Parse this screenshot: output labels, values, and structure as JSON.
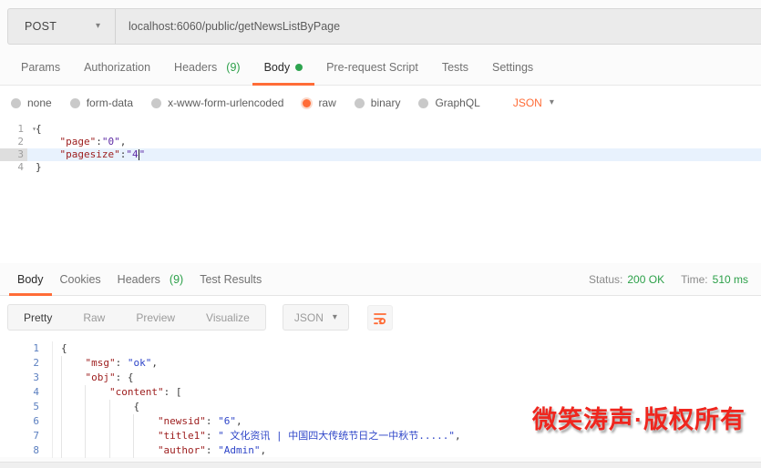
{
  "colors": {
    "accent": "#ff6c37",
    "success_green": "#2ca049",
    "watermark_red": "#ef261e"
  },
  "request": {
    "method": "POST",
    "url": "localhost:6060/public/getNewsListByPage",
    "tabs": [
      {
        "label": "Params"
      },
      {
        "label": "Authorization"
      },
      {
        "label": "Headers",
        "count": "(9)"
      },
      {
        "label": "Body",
        "active": true
      },
      {
        "label": "Pre-request Script"
      },
      {
        "label": "Tests"
      },
      {
        "label": "Settings"
      }
    ],
    "body_modes": [
      {
        "label": "none"
      },
      {
        "label": "form-data"
      },
      {
        "label": "x-www-form-urlencoded"
      },
      {
        "label": "raw",
        "selected": true
      },
      {
        "label": "binary"
      },
      {
        "label": "GraphQL"
      }
    ],
    "format": "JSON",
    "editor_lines": [
      {
        "n": "1",
        "fold": true,
        "indent": 0,
        "tokens": [
          {
            "c": "p",
            "t": "{"
          }
        ]
      },
      {
        "n": "2",
        "indent": 4,
        "tokens": [
          {
            "c": "key",
            "t": "\"page\""
          },
          {
            "c": "p",
            "t": ":"
          },
          {
            "c": "val",
            "t": "\"0\""
          },
          {
            "c": "p",
            "t": ","
          }
        ]
      },
      {
        "n": "3",
        "indent": 4,
        "active": true,
        "tokens": [
          {
            "c": "key",
            "t": "\"pagesize\""
          },
          {
            "c": "p",
            "t": ":"
          },
          {
            "c": "val",
            "t": "\"4"
          },
          {
            "c": "caret"
          },
          {
            "c": "val",
            "t": "\""
          }
        ]
      },
      {
        "n": "4",
        "indent": 0,
        "tokens": [
          {
            "c": "p",
            "t": "}"
          }
        ]
      }
    ]
  },
  "response": {
    "tabs": [
      {
        "label": "Body",
        "active": true
      },
      {
        "label": "Cookies"
      },
      {
        "label": "Headers",
        "count": "(9)"
      },
      {
        "label": "Test Results"
      }
    ],
    "status_label": "Status:",
    "status_value": "200 OK",
    "time_label": "Time:",
    "time_value": "510 ms",
    "view_tabs": [
      {
        "label": "Pretty",
        "active": true
      },
      {
        "label": "Raw"
      },
      {
        "label": "Preview"
      },
      {
        "label": "Visualize"
      }
    ],
    "format": "JSON",
    "editor_lines": [
      {
        "n": "1",
        "indent": 0,
        "tokens": [
          {
            "c": "p",
            "t": "{"
          }
        ]
      },
      {
        "n": "2",
        "indent": 4,
        "tokens": [
          {
            "c": "key",
            "t": "\"msg\""
          },
          {
            "c": "p",
            "t": ": "
          },
          {
            "c": "val",
            "t": "\"ok\""
          },
          {
            "c": "p",
            "t": ","
          }
        ]
      },
      {
        "n": "3",
        "indent": 4,
        "tokens": [
          {
            "c": "key",
            "t": "\"obj\""
          },
          {
            "c": "p",
            "t": ": {"
          }
        ]
      },
      {
        "n": "4",
        "indent": 8,
        "tokens": [
          {
            "c": "key",
            "t": "\"content\""
          },
          {
            "c": "p",
            "t": ": ["
          }
        ]
      },
      {
        "n": "5",
        "indent": 12,
        "tokens": [
          {
            "c": "p",
            "t": "{"
          }
        ]
      },
      {
        "n": "6",
        "indent": 16,
        "tokens": [
          {
            "c": "key",
            "t": "\"newsid\""
          },
          {
            "c": "p",
            "t": ": "
          },
          {
            "c": "val",
            "t": "\"6\""
          },
          {
            "c": "p",
            "t": ","
          }
        ]
      },
      {
        "n": "7",
        "indent": 16,
        "tokens": [
          {
            "c": "key",
            "t": "\"title1\""
          },
          {
            "c": "p",
            "t": ": "
          },
          {
            "c": "val",
            "t": "\" 文化资讯 | 中国四大传统节日之一中秋节.....\""
          },
          {
            "c": "p",
            "t": ","
          }
        ]
      },
      {
        "n": "8",
        "indent": 16,
        "tokens": [
          {
            "c": "key",
            "t": "\"author\""
          },
          {
            "c": "p",
            "t": ": "
          },
          {
            "c": "val",
            "t": "\"Admin\""
          },
          {
            "c": "p",
            "t": ","
          }
        ]
      }
    ]
  },
  "watermark": "微笑涛声·版权所有"
}
